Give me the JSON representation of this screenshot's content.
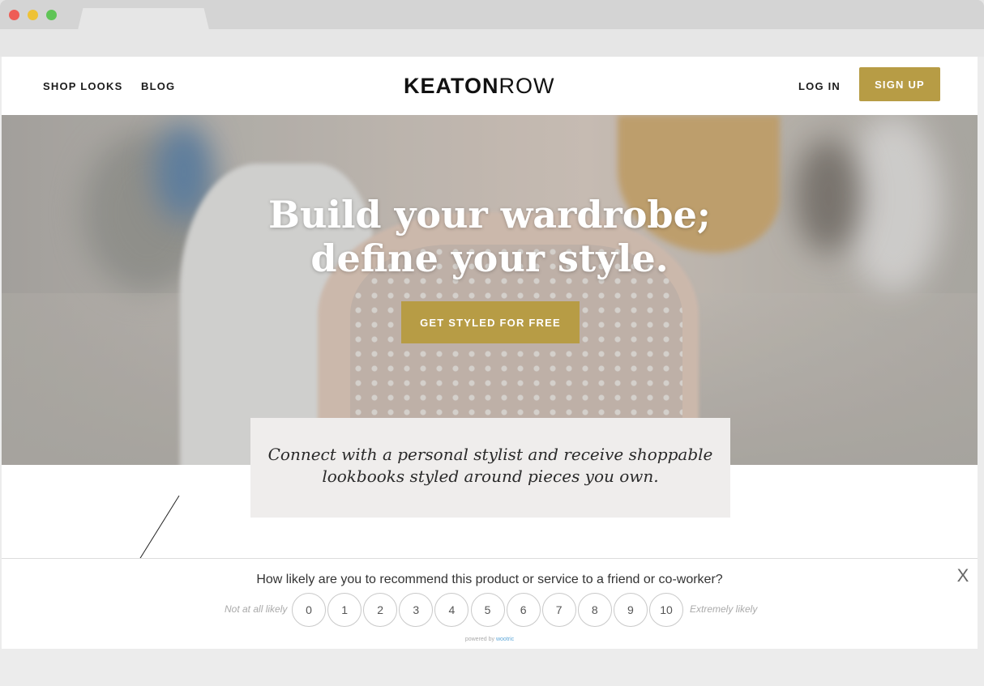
{
  "nav": {
    "shop_looks": "SHOP LOOKS",
    "blog": "BLOG",
    "logo_bold": "KEATON",
    "logo_light": "ROW",
    "login": "LOG IN",
    "signup": "SIGN UP"
  },
  "hero": {
    "headline_line1": "Build your wardrobe;",
    "headline_line2": "define your style.",
    "cta": "GET STYLED FOR FREE"
  },
  "tagline": {
    "line1": "Connect with a personal stylist and receive shoppable",
    "line2": "lookbooks styled around pieces you own."
  },
  "survey": {
    "question": "How likely are you to recommend this product or service to a friend or co-worker?",
    "low_label": "Not at all likely",
    "high_label": "Extremely likely",
    "scale": [
      "0",
      "1",
      "2",
      "3",
      "4",
      "5",
      "6",
      "7",
      "8",
      "9",
      "10"
    ],
    "close": "X",
    "powered_prefix": "powered by",
    "powered_brand": "wootric"
  },
  "colors": {
    "accent": "#b79c45",
    "text": "#1b1b1b",
    "tagline_bg": "#efedec"
  }
}
